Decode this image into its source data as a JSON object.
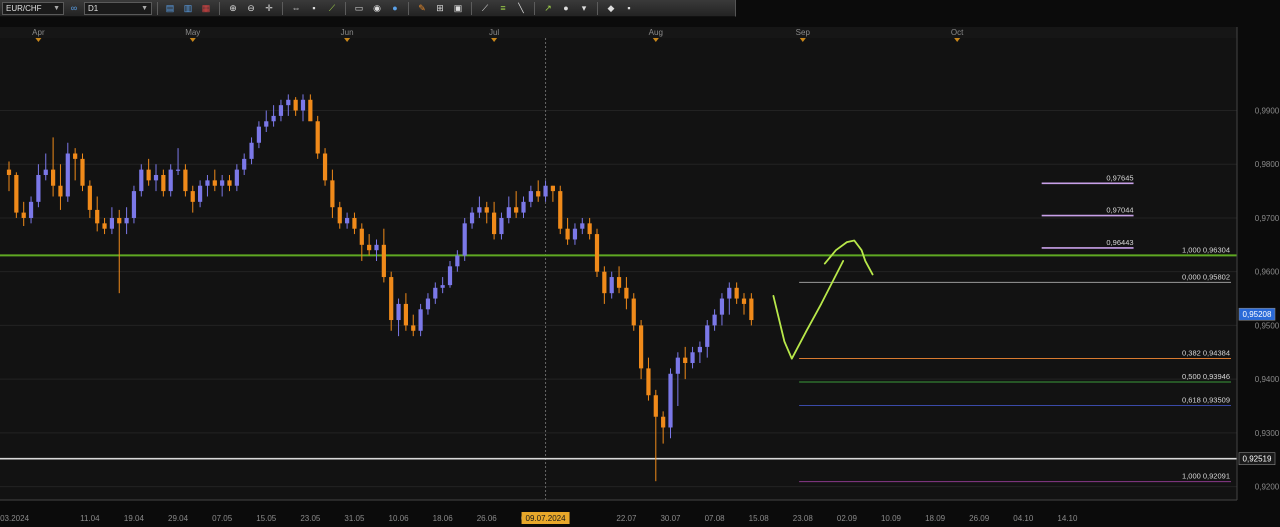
{
  "toolbar": {
    "symbol": "EUR/CHF",
    "period": "D1",
    "buttons": [
      {
        "name": "chart-type-icon",
        "glyph": "▤",
        "color": "blue"
      },
      {
        "name": "candle-settings-icon",
        "glyph": "▥",
        "color": "blue"
      },
      {
        "name": "indicator-icon",
        "glyph": "▦",
        "color": "red"
      },
      {
        "name": "zoom-in-icon",
        "glyph": "⊕",
        "color": "white"
      },
      {
        "name": "zoom-out-icon",
        "glyph": "⊖",
        "color": "white"
      },
      {
        "name": "crosshair-icon",
        "glyph": "✛",
        "color": "white"
      },
      {
        "name": "scroll-icon",
        "glyph": "⇔",
        "color": "white"
      },
      {
        "name": "cursor-icon",
        "glyph": "▪",
        "color": "white"
      },
      {
        "name": "trendline-icon",
        "glyph": "⟋",
        "color": "green"
      },
      {
        "name": "note-icon",
        "glyph": "▭",
        "color": "white"
      },
      {
        "name": "camera-icon",
        "glyph": "◉",
        "color": "white"
      },
      {
        "name": "palette-icon",
        "glyph": "●",
        "color": "blue"
      },
      {
        "name": "pencil-icon",
        "glyph": "✎",
        "color": "orange"
      },
      {
        "name": "grid-icon",
        "glyph": "⊞",
        "color": "white"
      },
      {
        "name": "text-icon",
        "glyph": "▣",
        "color": "white"
      },
      {
        "name": "fan-icon",
        "glyph": "⟋",
        "color": "white"
      },
      {
        "name": "fibonacci-icon",
        "glyph": "≡",
        "color": "green"
      },
      {
        "name": "line-icon",
        "glyph": "╲",
        "color": "white"
      },
      {
        "name": "arrow-icon",
        "glyph": "↗",
        "color": "green"
      },
      {
        "name": "sphere-icon",
        "glyph": "●",
        "color": "white"
      },
      {
        "name": "shapes-icon",
        "glyph": "▾",
        "color": "white"
      },
      {
        "name": "eraser-icon",
        "glyph": "◆",
        "color": "white"
      },
      {
        "name": "settings-icon",
        "glyph": "▪",
        "color": "white"
      }
    ]
  },
  "chart_data": {
    "type": "candlestick",
    "symbol": "EUR/CHF",
    "timeframe": "D1",
    "ylim": [
      0.9175,
      1.0035
    ],
    "y_ticks": [
      "0,9200",
      "0,9300",
      "0,9400",
      "0,9500",
      "0,9600",
      "0,9700",
      "0,9800",
      "0,9900"
    ],
    "y_tick_values": [
      0.92,
      0.93,
      0.94,
      0.95,
      0.96,
      0.97,
      0.98,
      0.99
    ],
    "month_labels": [
      {
        "label": "Apr",
        "index": 4
      },
      {
        "label": "May",
        "index": 25
      },
      {
        "label": "Jun",
        "index": 46
      },
      {
        "label": "Jul",
        "index": 66
      },
      {
        "label": "Aug",
        "index": 88
      },
      {
        "label": "Sep",
        "index": 108
      },
      {
        "label": "Oct",
        "index": 129
      }
    ],
    "date_labels": [
      {
        "label": "26.03.2024",
        "index": 0
      },
      {
        "label": "11.04",
        "index": 11
      },
      {
        "label": "19.04",
        "index": 17
      },
      {
        "label": "29.04",
        "index": 23
      },
      {
        "label": "07.05",
        "index": 29
      },
      {
        "label": "15.05",
        "index": 35
      },
      {
        "label": "23.05",
        "index": 41
      },
      {
        "label": "31.05",
        "index": 47
      },
      {
        "label": "10.06",
        "index": 53
      },
      {
        "label": "18.06",
        "index": 59
      },
      {
        "label": "26.06",
        "index": 65
      },
      {
        "label": "04.07",
        "index": 71
      },
      {
        "label": "22.07",
        "index": 84
      },
      {
        "label": "30.07",
        "index": 90
      },
      {
        "label": "07.08",
        "index": 96
      },
      {
        "label": "15.08",
        "index": 102
      },
      {
        "label": "23.08",
        "index": 108
      },
      {
        "label": "02.09",
        "index": 114
      },
      {
        "label": "10.09",
        "index": 120
      },
      {
        "label": "18.09",
        "index": 126
      },
      {
        "label": "26.09",
        "index": 132
      },
      {
        "label": "04.10",
        "index": 138
      },
      {
        "label": "14.10",
        "index": 144
      }
    ],
    "highlight_date": {
      "label": "09.07.2024",
      "index": 73
    },
    "bull_color": "#7b78e8",
    "bear_color": "#f08a1a",
    "candles": [
      [
        0.979,
        0.9805,
        0.975,
        0.978
      ],
      [
        0.978,
        0.9785,
        0.97,
        0.971
      ],
      [
        0.971,
        0.973,
        0.9685,
        0.97
      ],
      [
        0.97,
        0.974,
        0.969,
        0.973
      ],
      [
        0.973,
        0.98,
        0.972,
        0.978
      ],
      [
        0.978,
        0.982,
        0.977,
        0.979
      ],
      [
        0.979,
        0.985,
        0.974,
        0.976
      ],
      [
        0.976,
        0.98,
        0.9715,
        0.974
      ],
      [
        0.974,
        0.984,
        0.973,
        0.982
      ],
      [
        0.982,
        0.983,
        0.977,
        0.981
      ],
      [
        0.981,
        0.982,
        0.975,
        0.976
      ],
      [
        0.976,
        0.977,
        0.97,
        0.9715
      ],
      [
        0.9715,
        0.974,
        0.9675,
        0.969
      ],
      [
        0.969,
        0.97,
        0.967,
        0.968
      ],
      [
        0.968,
        0.972,
        0.967,
        0.97
      ],
      [
        0.97,
        0.9715,
        0.956,
        0.969
      ],
      [
        0.969,
        0.972,
        0.967,
        0.97
      ],
      [
        0.97,
        0.976,
        0.969,
        0.975
      ],
      [
        0.975,
        0.98,
        0.974,
        0.979
      ],
      [
        0.979,
        0.981,
        0.976,
        0.977
      ],
      [
        0.977,
        0.98,
        0.975,
        0.978
      ],
      [
        0.978,
        0.979,
        0.974,
        0.975
      ],
      [
        0.975,
        0.98,
        0.974,
        0.979
      ],
      [
        0.979,
        0.983,
        0.978,
        0.979
      ],
      [
        0.979,
        0.98,
        0.974,
        0.975
      ],
      [
        0.975,
        0.976,
        0.971,
        0.973
      ],
      [
        0.973,
        0.977,
        0.972,
        0.976
      ],
      [
        0.976,
        0.978,
        0.974,
        0.977
      ],
      [
        0.977,
        0.979,
        0.975,
        0.976
      ],
      [
        0.976,
        0.978,
        0.974,
        0.977
      ],
      [
        0.977,
        0.978,
        0.975,
        0.976
      ],
      [
        0.976,
        0.98,
        0.975,
        0.979
      ],
      [
        0.979,
        0.982,
        0.978,
        0.981
      ],
      [
        0.981,
        0.985,
        0.98,
        0.984
      ],
      [
        0.984,
        0.988,
        0.983,
        0.987
      ],
      [
        0.987,
        0.99,
        0.986,
        0.988
      ],
      [
        0.988,
        0.991,
        0.987,
        0.989
      ],
      [
        0.989,
        0.992,
        0.988,
        0.991
      ],
      [
        0.991,
        0.993,
        0.989,
        0.992
      ],
      [
        0.992,
        0.9925,
        0.989,
        0.99
      ],
      [
        0.99,
        0.993,
        0.988,
        0.992
      ],
      [
        0.992,
        0.993,
        0.989,
        0.988
      ],
      [
        0.988,
        0.989,
        0.981,
        0.982
      ],
      [
        0.982,
        0.983,
        0.976,
        0.977
      ],
      [
        0.977,
        0.979,
        0.97,
        0.972
      ],
      [
        0.972,
        0.973,
        0.968,
        0.969
      ],
      [
        0.969,
        0.971,
        0.968,
        0.97
      ],
      [
        0.97,
        0.971,
        0.967,
        0.968
      ],
      [
        0.968,
        0.969,
        0.962,
        0.965
      ],
      [
        0.965,
        0.967,
        0.963,
        0.964
      ],
      [
        0.964,
        0.966,
        0.962,
        0.965
      ],
      [
        0.965,
        0.968,
        0.958,
        0.959
      ],
      [
        0.959,
        0.96,
        0.949,
        0.951
      ],
      [
        0.951,
        0.955,
        0.948,
        0.954
      ],
      [
        0.954,
        0.956,
        0.949,
        0.95
      ],
      [
        0.95,
        0.952,
        0.948,
        0.949
      ],
      [
        0.949,
        0.954,
        0.948,
        0.953
      ],
      [
        0.953,
        0.956,
        0.952,
        0.955
      ],
      [
        0.955,
        0.958,
        0.954,
        0.957
      ],
      [
        0.957,
        0.959,
        0.956,
        0.9575
      ],
      [
        0.9575,
        0.962,
        0.957,
        0.961
      ],
      [
        0.961,
        0.964,
        0.96,
        0.963
      ],
      [
        0.963,
        0.97,
        0.962,
        0.969
      ],
      [
        0.969,
        0.972,
        0.968,
        0.971
      ],
      [
        0.971,
        0.974,
        0.97,
        0.972
      ],
      [
        0.972,
        0.973,
        0.969,
        0.971
      ],
      [
        0.971,
        0.973,
        0.966,
        0.967
      ],
      [
        0.967,
        0.971,
        0.966,
        0.97
      ],
      [
        0.97,
        0.974,
        0.969,
        0.972
      ],
      [
        0.972,
        0.975,
        0.97,
        0.971
      ],
      [
        0.971,
        0.974,
        0.97,
        0.973
      ],
      [
        0.973,
        0.976,
        0.972,
        0.975
      ],
      [
        0.975,
        0.977,
        0.973,
        0.974
      ],
      [
        0.974,
        0.977,
        0.973,
        0.976
      ],
      [
        0.976,
        0.976,
        0.973,
        0.975
      ],
      [
        0.975,
        0.976,
        0.967,
        0.968
      ],
      [
        0.968,
        0.97,
        0.965,
        0.966
      ],
      [
        0.966,
        0.969,
        0.965,
        0.968
      ],
      [
        0.968,
        0.97,
        0.967,
        0.969
      ],
      [
        0.969,
        0.97,
        0.966,
        0.967
      ],
      [
        0.967,
        0.968,
        0.959,
        0.96
      ],
      [
        0.96,
        0.961,
        0.954,
        0.956
      ],
      [
        0.956,
        0.96,
        0.955,
        0.959
      ],
      [
        0.959,
        0.961,
        0.956,
        0.957
      ],
      [
        0.957,
        0.959,
        0.953,
        0.955
      ],
      [
        0.955,
        0.956,
        0.949,
        0.95
      ],
      [
        0.95,
        0.951,
        0.94,
        0.942
      ],
      [
        0.942,
        0.944,
        0.936,
        0.937
      ],
      [
        0.937,
        0.938,
        0.921,
        0.933
      ],
      [
        0.933,
        0.934,
        0.928,
        0.931
      ],
      [
        0.931,
        0.942,
        0.929,
        0.941
      ],
      [
        0.941,
        0.945,
        0.935,
        0.944
      ],
      [
        0.944,
        0.946,
        0.94,
        0.943
      ],
      [
        0.943,
        0.946,
        0.942,
        0.945
      ],
      [
        0.945,
        0.947,
        0.943,
        0.946
      ],
      [
        0.946,
        0.951,
        0.944,
        0.95
      ],
      [
        0.95,
        0.953,
        0.949,
        0.952
      ],
      [
        0.952,
        0.956,
        0.95,
        0.955
      ],
      [
        0.955,
        0.958,
        0.952,
        0.957
      ],
      [
        0.957,
        0.958,
        0.954,
        0.955
      ],
      [
        0.955,
        0.956,
        0.952,
        0.954
      ],
      [
        0.955,
        0.956,
        0.95,
        0.951
      ]
    ],
    "horizontal_lines": [
      {
        "price": 0.96304,
        "color": "#5fa822",
        "width": 2
      },
      {
        "price": 0.92519,
        "color": "#d8d8d8",
        "width": 1.6
      }
    ],
    "fib_target_lines": [
      {
        "price": 0.97645,
        "label": "0,97645"
      },
      {
        "price": 0.97044,
        "label": "0,97044"
      },
      {
        "price": 0.96443,
        "label": "0,96443"
      }
    ],
    "fib_target_color": "#c8a0e8",
    "fib_levels": [
      {
        "price": 0.96304,
        "label": "1,000  0,96304",
        "color": "#5fa822"
      },
      {
        "price": 0.95802,
        "label": "0,000  0,95802",
        "color": "#9a9a9a"
      },
      {
        "price": 0.94384,
        "label": "0,382  0,94384",
        "color": "#d87a30"
      },
      {
        "price": 0.93946,
        "label": "0,500  0,93946",
        "color": "#3a9a3a"
      },
      {
        "price": 0.93509,
        "label": "0,618  0,93509",
        "color": "#3a4aa8"
      },
      {
        "price": 0.92091,
        "label": "1,000  0,92091",
        "color": "#8a3a8a"
      }
    ],
    "price_tags": [
      {
        "price": 0.95208,
        "label": "0,95208",
        "bg": "#2a6ad8",
        "fg": "#ffffff"
      },
      {
        "price": 0.92519,
        "label": "0,92519",
        "bg": "#1a1a1a",
        "fg": "#ffffff"
      }
    ],
    "drawn_path_color": "#b8e84a",
    "drawn_path": [
      [
        104.0,
        0.9555
      ],
      [
        105.5,
        0.947
      ],
      [
        106.5,
        0.9438
      ],
      [
        108.5,
        0.949
      ],
      [
        110.5,
        0.954
      ],
      [
        112.0,
        0.958
      ],
      [
        113.5,
        0.962
      ],
      [
        111.0,
        0.9615
      ],
      [
        112.5,
        0.964
      ],
      [
        114.0,
        0.9655
      ],
      [
        115.0,
        0.9658
      ],
      [
        116.0,
        0.964
      ],
      [
        116.5,
        0.962
      ],
      [
        117.5,
        0.9595
      ]
    ]
  }
}
